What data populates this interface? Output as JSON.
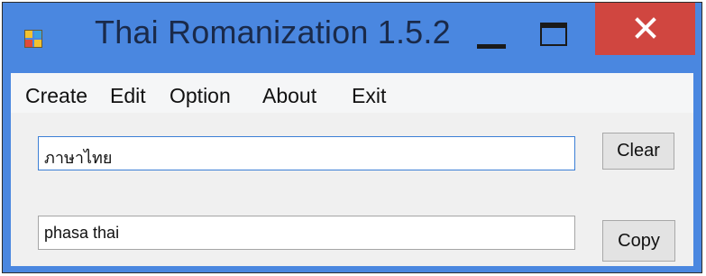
{
  "window": {
    "title": "Thai Romanization 1.5.2",
    "colors": {
      "titlebar": "#4a87e0",
      "close": "#d04640",
      "client": "#f0f0f0"
    }
  },
  "icons": {
    "app": "app-icon",
    "minimize": "minimize-icon",
    "maximize": "maximize-icon",
    "close": "close-icon"
  },
  "menu": {
    "items": [
      {
        "label": "Create"
      },
      {
        "label": "Edit"
      },
      {
        "label": "Option"
      },
      {
        "label": "About"
      },
      {
        "label": "Exit"
      }
    ]
  },
  "main": {
    "thai_input": {
      "value": "ภาษาไทย"
    },
    "clear_label": "Clear",
    "roman_output": {
      "value": "phasa thai"
    },
    "copy_label": "Copy"
  }
}
